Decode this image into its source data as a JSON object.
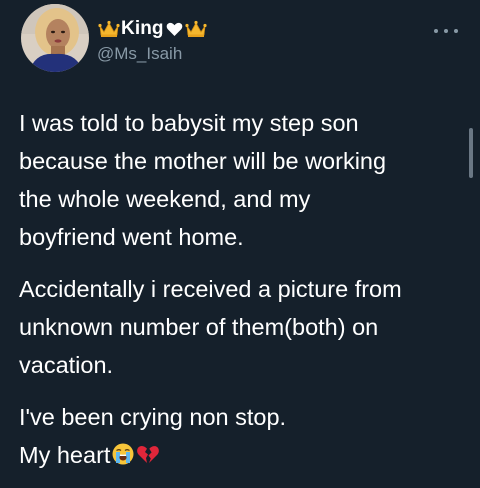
{
  "tweet": {
    "display_name": "King",
    "handle": "@Ms_Isaih",
    "name_icons": {
      "left": "crown-icon",
      "middle": "white-heart-icon",
      "right": "crown-icon"
    },
    "more_icon": "more-options-icon",
    "body": {
      "paragraph_1": [
        "I was told to babysit my step son",
        "because the mother will be working",
        "the whole weekend, and my",
        "boyfriend went home."
      ],
      "paragraph_2": [
        "Accidentally i received a picture from",
        "unknown number of them(both) on",
        "vacation."
      ],
      "paragraph_3": [
        "I've been crying non stop.",
        "My heart"
      ],
      "trailing_emojis": [
        "loudly-crying-face-icon",
        "broken-heart-icon"
      ]
    }
  },
  "colors": {
    "background": "#15202b",
    "text": "#ffffff",
    "secondary_text": "#8899a6",
    "crown": "#f5b72e",
    "broken_heart": "#e0263a"
  }
}
